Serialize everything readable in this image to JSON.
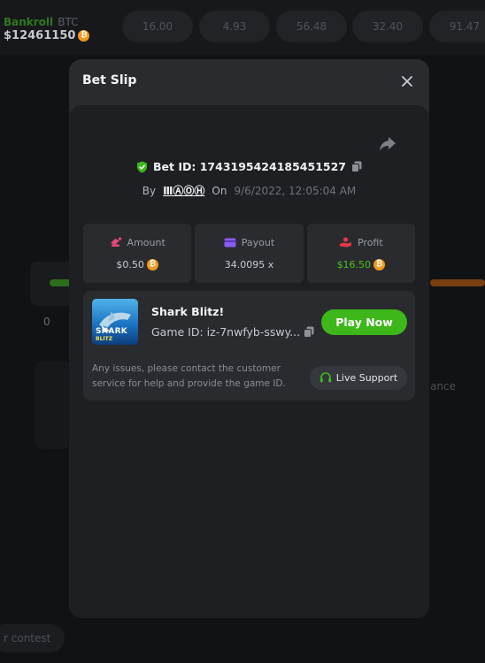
{
  "background": {
    "bankroll_label": "Bankroll",
    "currency": "BTC",
    "balance": "$12461150",
    "chips": [
      "16.00",
      "4.93",
      "56.48",
      "32.40",
      "91.47"
    ],
    "zero_label": "0",
    "ance_label": "ance",
    "contest_label": "r contest"
  },
  "modal": {
    "title": "Bet Slip",
    "bet_id": "Bet ID: 1743195424185451527",
    "by_label": "By",
    "username": "ⅢⒶⓄⒽ",
    "on_label": "On",
    "date": "9/6/2022, 12:05:04 AM",
    "stats": {
      "amount": {
        "label": "Amount",
        "value": "$0.50"
      },
      "payout": {
        "label": "Payout",
        "value": "34.0095 x"
      },
      "profit": {
        "label": "Profit",
        "value": "$16.50"
      }
    },
    "game": {
      "thumb_title": "SHARK",
      "thumb_sub": "BLITZ",
      "name": "Shark Blitz!",
      "game_id": "Game ID: iz-7nwfyb-sswy...",
      "play_button": "Play Now",
      "note": "Any issues, please contact the customer service for help and provide the game ID.",
      "support_button": "Live Support"
    }
  },
  "colors": {
    "accent_green": "#3db71a",
    "profit_green": "#48c21c",
    "btc_orange": "#f29a1f",
    "modal_bg": "#2a2b2f",
    "modal_body_bg": "#1e1f22"
  },
  "icons": {
    "close": "close-icon",
    "share": "share-icon",
    "shield": "shield-check-icon",
    "copy": "copy-icon",
    "amount": "amount-icon",
    "payout": "payout-card-icon",
    "profit": "profit-hand-icon",
    "headset": "headset-icon",
    "btc": "bitcoin-icon"
  }
}
